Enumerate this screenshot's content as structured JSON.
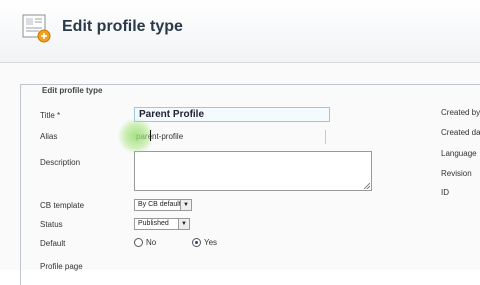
{
  "header": {
    "title": "Edit profile type",
    "icon": "profile-edit-icon"
  },
  "form": {
    "legend": "Edit profile type",
    "fields": {
      "title_label": "Title *",
      "title_value": "Parent Profile",
      "alias_label": "Alias",
      "alias_value": "parent-profile",
      "description_label": "Description",
      "description_value": "",
      "cb_template_label": "CB template",
      "cb_template_value": "By CB default",
      "status_label": "Status",
      "status_value": "Published",
      "default_label": "Default",
      "default_no": "No",
      "default_yes": "Yes",
      "default_selected": "Yes",
      "profile_page_label": "Profile page"
    }
  },
  "details": {
    "created_by": "Created by",
    "created_date": "Created da",
    "language": "Language",
    "revision": "Revision",
    "id": "ID"
  },
  "colors": {
    "title_color": "#2b3a4a",
    "input_border": "#99c8df",
    "cursor_highlight": "#9fe07a"
  }
}
